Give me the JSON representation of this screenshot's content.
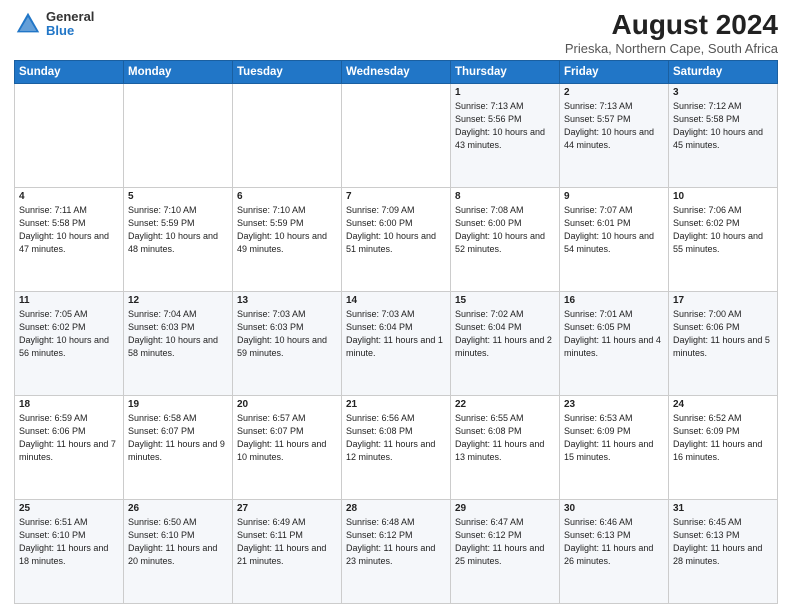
{
  "header": {
    "logo_general": "General",
    "logo_blue": "Blue",
    "title": "August 2024",
    "subtitle": "Prieska, Northern Cape, South Africa"
  },
  "weekdays": [
    "Sunday",
    "Monday",
    "Tuesday",
    "Wednesday",
    "Thursday",
    "Friday",
    "Saturday"
  ],
  "weeks": [
    [
      {
        "day": "",
        "sunrise": "",
        "sunset": "",
        "daylight": ""
      },
      {
        "day": "",
        "sunrise": "",
        "sunset": "",
        "daylight": ""
      },
      {
        "day": "",
        "sunrise": "",
        "sunset": "",
        "daylight": ""
      },
      {
        "day": "",
        "sunrise": "",
        "sunset": "",
        "daylight": ""
      },
      {
        "day": "1",
        "sunrise": "Sunrise: 7:13 AM",
        "sunset": "Sunset: 5:56 PM",
        "daylight": "Daylight: 10 hours and 43 minutes."
      },
      {
        "day": "2",
        "sunrise": "Sunrise: 7:13 AM",
        "sunset": "Sunset: 5:57 PM",
        "daylight": "Daylight: 10 hours and 44 minutes."
      },
      {
        "day": "3",
        "sunrise": "Sunrise: 7:12 AM",
        "sunset": "Sunset: 5:58 PM",
        "daylight": "Daylight: 10 hours and 45 minutes."
      }
    ],
    [
      {
        "day": "4",
        "sunrise": "Sunrise: 7:11 AM",
        "sunset": "Sunset: 5:58 PM",
        "daylight": "Daylight: 10 hours and 47 minutes."
      },
      {
        "day": "5",
        "sunrise": "Sunrise: 7:10 AM",
        "sunset": "Sunset: 5:59 PM",
        "daylight": "Daylight: 10 hours and 48 minutes."
      },
      {
        "day": "6",
        "sunrise": "Sunrise: 7:10 AM",
        "sunset": "Sunset: 5:59 PM",
        "daylight": "Daylight: 10 hours and 49 minutes."
      },
      {
        "day": "7",
        "sunrise": "Sunrise: 7:09 AM",
        "sunset": "Sunset: 6:00 PM",
        "daylight": "Daylight: 10 hours and 51 minutes."
      },
      {
        "day": "8",
        "sunrise": "Sunrise: 7:08 AM",
        "sunset": "Sunset: 6:00 PM",
        "daylight": "Daylight: 10 hours and 52 minutes."
      },
      {
        "day": "9",
        "sunrise": "Sunrise: 7:07 AM",
        "sunset": "Sunset: 6:01 PM",
        "daylight": "Daylight: 10 hours and 54 minutes."
      },
      {
        "day": "10",
        "sunrise": "Sunrise: 7:06 AM",
        "sunset": "Sunset: 6:02 PM",
        "daylight": "Daylight: 10 hours and 55 minutes."
      }
    ],
    [
      {
        "day": "11",
        "sunrise": "Sunrise: 7:05 AM",
        "sunset": "Sunset: 6:02 PM",
        "daylight": "Daylight: 10 hours and 56 minutes."
      },
      {
        "day": "12",
        "sunrise": "Sunrise: 7:04 AM",
        "sunset": "Sunset: 6:03 PM",
        "daylight": "Daylight: 10 hours and 58 minutes."
      },
      {
        "day": "13",
        "sunrise": "Sunrise: 7:03 AM",
        "sunset": "Sunset: 6:03 PM",
        "daylight": "Daylight: 10 hours and 59 minutes."
      },
      {
        "day": "14",
        "sunrise": "Sunrise: 7:03 AM",
        "sunset": "Sunset: 6:04 PM",
        "daylight": "Daylight: 11 hours and 1 minute."
      },
      {
        "day": "15",
        "sunrise": "Sunrise: 7:02 AM",
        "sunset": "Sunset: 6:04 PM",
        "daylight": "Daylight: 11 hours and 2 minutes."
      },
      {
        "day": "16",
        "sunrise": "Sunrise: 7:01 AM",
        "sunset": "Sunset: 6:05 PM",
        "daylight": "Daylight: 11 hours and 4 minutes."
      },
      {
        "day": "17",
        "sunrise": "Sunrise: 7:00 AM",
        "sunset": "Sunset: 6:06 PM",
        "daylight": "Daylight: 11 hours and 5 minutes."
      }
    ],
    [
      {
        "day": "18",
        "sunrise": "Sunrise: 6:59 AM",
        "sunset": "Sunset: 6:06 PM",
        "daylight": "Daylight: 11 hours and 7 minutes."
      },
      {
        "day": "19",
        "sunrise": "Sunrise: 6:58 AM",
        "sunset": "Sunset: 6:07 PM",
        "daylight": "Daylight: 11 hours and 9 minutes."
      },
      {
        "day": "20",
        "sunrise": "Sunrise: 6:57 AM",
        "sunset": "Sunset: 6:07 PM",
        "daylight": "Daylight: 11 hours and 10 minutes."
      },
      {
        "day": "21",
        "sunrise": "Sunrise: 6:56 AM",
        "sunset": "Sunset: 6:08 PM",
        "daylight": "Daylight: 11 hours and 12 minutes."
      },
      {
        "day": "22",
        "sunrise": "Sunrise: 6:55 AM",
        "sunset": "Sunset: 6:08 PM",
        "daylight": "Daylight: 11 hours and 13 minutes."
      },
      {
        "day": "23",
        "sunrise": "Sunrise: 6:53 AM",
        "sunset": "Sunset: 6:09 PM",
        "daylight": "Daylight: 11 hours and 15 minutes."
      },
      {
        "day": "24",
        "sunrise": "Sunrise: 6:52 AM",
        "sunset": "Sunset: 6:09 PM",
        "daylight": "Daylight: 11 hours and 16 minutes."
      }
    ],
    [
      {
        "day": "25",
        "sunrise": "Sunrise: 6:51 AM",
        "sunset": "Sunset: 6:10 PM",
        "daylight": "Daylight: 11 hours and 18 minutes."
      },
      {
        "day": "26",
        "sunrise": "Sunrise: 6:50 AM",
        "sunset": "Sunset: 6:10 PM",
        "daylight": "Daylight: 11 hours and 20 minutes."
      },
      {
        "day": "27",
        "sunrise": "Sunrise: 6:49 AM",
        "sunset": "Sunset: 6:11 PM",
        "daylight": "Daylight: 11 hours and 21 minutes."
      },
      {
        "day": "28",
        "sunrise": "Sunrise: 6:48 AM",
        "sunset": "Sunset: 6:12 PM",
        "daylight": "Daylight: 11 hours and 23 minutes."
      },
      {
        "day": "29",
        "sunrise": "Sunrise: 6:47 AM",
        "sunset": "Sunset: 6:12 PM",
        "daylight": "Daylight: 11 hours and 25 minutes."
      },
      {
        "day": "30",
        "sunrise": "Sunrise: 6:46 AM",
        "sunset": "Sunset: 6:13 PM",
        "daylight": "Daylight: 11 hours and 26 minutes."
      },
      {
        "day": "31",
        "sunrise": "Sunrise: 6:45 AM",
        "sunset": "Sunset: 6:13 PM",
        "daylight": "Daylight: 11 hours and 28 minutes."
      }
    ]
  ]
}
